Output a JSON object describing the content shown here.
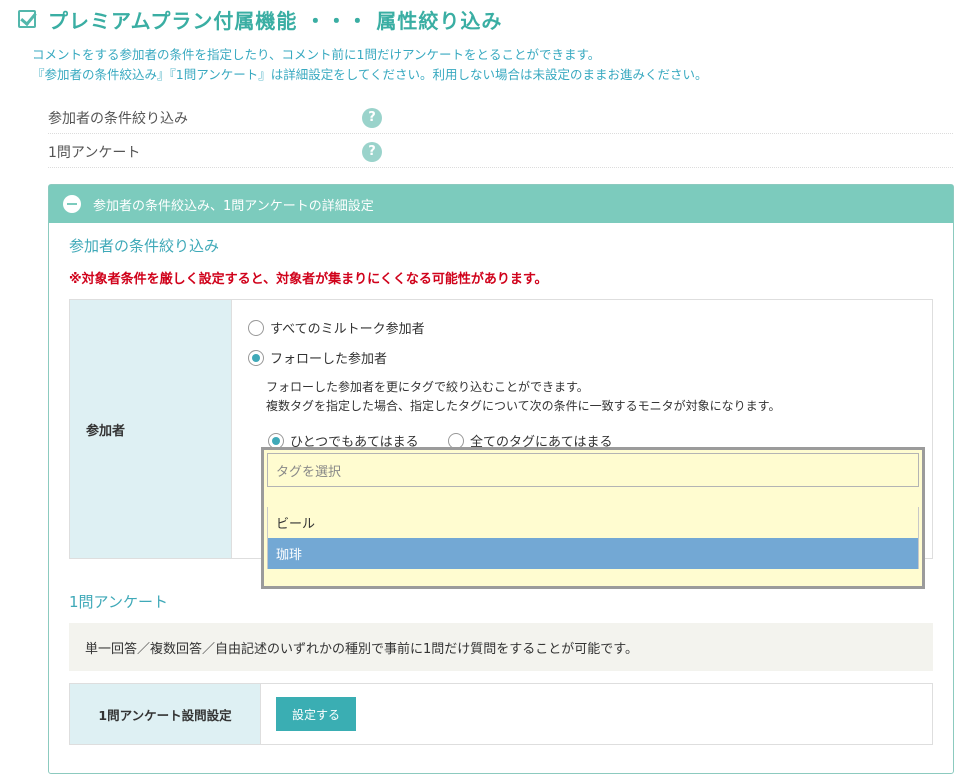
{
  "header": {
    "title": "プレミアムプラン付属機能 ・・・ 属性絞り込み",
    "description_line1": "コメントをする参加者の条件を指定したり、コメント前に1問だけアンケートをとることができます。",
    "description_line2": "『参加者の条件絞込み』『1問アンケート』は詳細設定をしてください。利用しない場合は未設定のままお進みください。"
  },
  "options": [
    {
      "label": "参加者の条件絞り込み",
      "help": "?"
    },
    {
      "label": "1問アンケート",
      "help": "?"
    }
  ],
  "panel": {
    "header": "参加者の条件絞込み、1問アンケートの詳細設定",
    "filter_section_title": "参加者の条件絞り込み",
    "warning": "※対象者条件を厳しく設定すると、対象者が集まりにくくなる可能性があります。",
    "participants_label": "参加者",
    "radio_all": "すべてのミルトーク参加者",
    "radio_follow": "フォローした参加者",
    "note_line1": "フォローした参加者を更にタグで絞り込むことができます。",
    "note_line2": "複数タグを指定した場合、指定したタグについて次の条件に一致するモニタが対象になります。",
    "radio_any": "ひとつでもあてはまる",
    "radio_every": "全てのタグにあてはまる",
    "survey_section_title": "1問アンケート",
    "survey_note": "単一回答／複数回答／自由記述のいずれかの種別で事前に1問だけ質問をすることが可能です。",
    "survey_label": "1問アンケート設問設定",
    "survey_button": "設定する"
  },
  "tag_select": {
    "placeholder": "タグを選択",
    "items": [
      {
        "label": "ビール"
      },
      {
        "label": "珈琲"
      }
    ]
  },
  "colors": {
    "accent": "#3aaea3",
    "panel_header": "#7ccbbd",
    "warning": "#d0021b",
    "dropdown_bg": "#fffcd0",
    "highlight": "#73a8d4"
  }
}
